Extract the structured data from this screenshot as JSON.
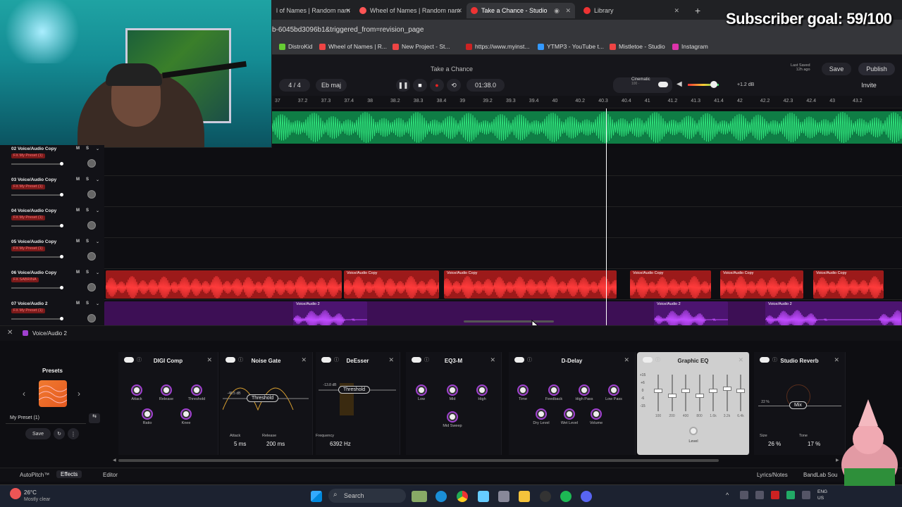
{
  "overlay": {
    "subscriber_goal": "Subscriber goal: 59/100"
  },
  "browser": {
    "tabs": [
      {
        "label": "l of Names | Random nam",
        "active": false,
        "color": "#d33"
      },
      {
        "label": "Wheel of Names | Random nam",
        "active": false,
        "color": "#f55"
      },
      {
        "label": "Take a Chance - Studio",
        "active": true,
        "color": "#e33"
      },
      {
        "label": "Library",
        "active": false,
        "color": "#e33"
      }
    ],
    "url": "b-6045bd3096b1&triggered_from=revision_page",
    "bookmarks": [
      {
        "label": "DistroKid",
        "color": "#6c3"
      },
      {
        "label": "Wheel of Names | R...",
        "color": "#e44"
      },
      {
        "label": "New Project - St...",
        "color": "#e44"
      },
      {
        "label": "https://www.myinst...",
        "color": "#c22"
      },
      {
        "label": "YTMP3 - YouTube t...",
        "color": "#39f"
      },
      {
        "label": "Mistletoe - Studio",
        "color": "#e44"
      },
      {
        "label": "Instagram",
        "color": "#d3a"
      }
    ]
  },
  "daw": {
    "project_title": "Take a Chance",
    "time_sig": "4 / 4",
    "key": "Eb maj",
    "time": "01:38.0",
    "preset_name": "Cinematic",
    "preset_sub": "100 ·",
    "gain": "+1.2 dB",
    "last_saved": "Last Saved\n12h ago",
    "save_label": "Save",
    "publish_label": "Publish",
    "invite_label": "Invite",
    "ruler_ticks": [
      "37",
      "37.2",
      "37.3",
      "37.4",
      "38",
      "38.2",
      "38.3",
      "38.4",
      "39",
      "39.2",
      "39.3",
      "39.4",
      "40",
      "40.2",
      "40.3",
      "40.4",
      "41",
      "41.2",
      "41.3",
      "41.4",
      "42",
      "42.2",
      "42.3",
      "42.4",
      "43",
      "43.2"
    ]
  },
  "tracks": [
    {
      "num": "02",
      "name": "Voice/Audio Copy",
      "fx": "FX My Preset (1)"
    },
    {
      "num": "03",
      "name": "Voice/Audio Copy",
      "fx": "FX My Preset (1)"
    },
    {
      "num": "04",
      "name": "Voice/Audio Copy",
      "fx": "FX My Preset (1)"
    },
    {
      "num": "05",
      "name": "Voice/Audio Copy",
      "fx": "FX My Preset (1)"
    },
    {
      "num": "06",
      "name": "Voice/Audio Copy",
      "fx": "FX SABRINA"
    },
    {
      "num": "07",
      "name": "Voice/Audio 2",
      "fx": "FX My Preset (1)"
    }
  ],
  "clips": {
    "red_label": "Voice/Audio Copy",
    "purple_label": "Voice/Audio 2"
  },
  "fx_panel": {
    "track_label": "Voice/Audio 2",
    "presets_label": "Presets",
    "preset_select": "My Preset (1)",
    "save_label": "Save",
    "plugins": [
      {
        "name": "DIGI Comp",
        "knobs": [
          "Attack",
          "Release",
          "Threshold",
          "Ratio",
          "Knee"
        ]
      },
      {
        "name": "Noise Gate",
        "threshold": "Threshold",
        "attack_label": "Attack",
        "attack": "5 ms",
        "release_label": "Release",
        "release": "200 ms",
        "level_tag": "-48.5 dB"
      },
      {
        "name": "DeEsser",
        "threshold": "Threshold",
        "freq_label": "Frequency",
        "freq": "6392 Hz",
        "level_tag": "-13.8 dB"
      },
      {
        "name": "EQ3-M",
        "knobs": [
          "Low",
          "Mid",
          "High",
          "Mid Sweep"
        ]
      },
      {
        "name": "D-Delay",
        "knobs": [
          "Time",
          "Feedback",
          "High Pass",
          "Low Pass",
          "Dry Level",
          "Wet Level",
          "Volume"
        ]
      },
      {
        "name": "Graphic EQ",
        "level": "Level",
        "bands": [
          "100",
          "200",
          "400",
          "800",
          "1.6k",
          "3.2k",
          "6.4k"
        ],
        "db_labels": [
          "+15",
          "+6",
          "0",
          "-6",
          "-15"
        ]
      },
      {
        "name": "Studio Reverb",
        "mix": "Mix",
        "size_label": "Size",
        "size": "26 %",
        "tone_label": "Tone",
        "tone": "17 %",
        "pct": "22 %"
      }
    ]
  },
  "bottom": {
    "autopitch": "AutoPitch™",
    "effects": "Effects",
    "editor": "Editor",
    "lyrics": "Lyrics/Notes",
    "bandlab": "BandLab Sou"
  },
  "taskbar": {
    "weather_temp": "26°C",
    "weather_desc": "Mostly clear",
    "search": "Search",
    "lang": "ENG\nUS"
  }
}
